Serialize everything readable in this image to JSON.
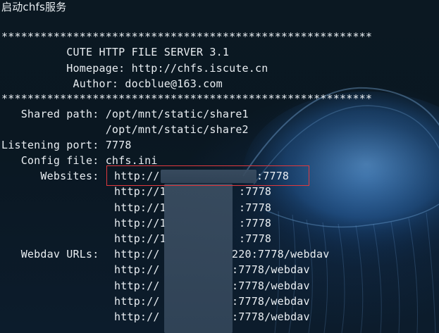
{
  "window": {
    "title_command": "启动chfs服务"
  },
  "banner": {
    "separator": "*********************************************************",
    "title": "          CUTE HTTP FILE SERVER 3.1",
    "homepage": "          Homepage: http://chfs.iscute.cn",
    "author": "           Author: docblue@163.com"
  },
  "config": {
    "shared_path_label": "   Shared path: ",
    "shared_path_1": "/opt/mnt/static/share1",
    "shared_path_2_indent": "                ",
    "shared_path_2": "/opt/mnt/static/share2",
    "listening_port_label": "Listening port: ",
    "listening_port": "7778",
    "config_file_label": "   Config file: ",
    "config_file": "chfs.ini",
    "websites_label": "      Websites: "
  },
  "websites": [
    {
      "prefix": "http://",
      "suffix": ":7778"
    },
    {
      "prefix": "http://1",
      "suffix": ":7778"
    },
    {
      "prefix": "http://1",
      "suffix": ":7778"
    },
    {
      "prefix": "http://1",
      "suffix": ":7778"
    },
    {
      "prefix": "http://1",
      "suffix": ":7778"
    }
  ],
  "webdav": {
    "label": "   Webdav URLs: ",
    "urls": [
      {
        "prefix": "http://",
        "suffix": "220:7778/webdav"
      },
      {
        "prefix": "http://",
        "suffix": ":7778/webdav"
      },
      {
        "prefix": "http://",
        "suffix": ":7778/webdav"
      },
      {
        "prefix": "http://",
        "suffix": ":7778/webdav"
      },
      {
        "prefix": "http://",
        "suffix": ":7778/webdav"
      }
    ]
  },
  "colors": {
    "text": "#e9eef2",
    "background": "#0a1520",
    "highlight_border": "#e0393e",
    "redaction": "#3b4e62"
  }
}
